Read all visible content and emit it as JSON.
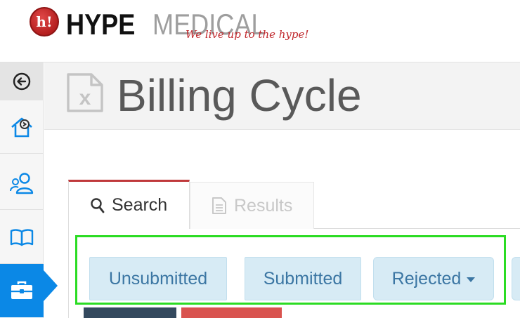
{
  "brand": {
    "badge_text": "h!",
    "name_part_1": "HYPE",
    "name_part_2": "MEDICAL",
    "tagline": "We live up to the hype!",
    "colors": {
      "red": "#c0282d",
      "gray": "#9e9e9e"
    }
  },
  "sidebar": {
    "toggle_icon": "arrow-circle-left-icon",
    "items": [
      {
        "icon": "home-icon",
        "active": false
      },
      {
        "icon": "users-icon",
        "active": false
      },
      {
        "icon": "book-icon",
        "active": false
      },
      {
        "icon": "briefcase-icon",
        "active": true
      }
    ],
    "active_color": "#0b88e6"
  },
  "page": {
    "title": "Billing Cycle",
    "title_icon": "excel-file-icon"
  },
  "tabs": [
    {
      "label": "Search",
      "icon": "search-icon",
      "active": true
    },
    {
      "label": "Results",
      "icon": "document-icon",
      "active": false
    }
  ],
  "status_filter": {
    "buttons": [
      {
        "label": "Unsubmitted"
      },
      {
        "label": "Submitted"
      },
      {
        "label": "Rejected",
        "has_dropdown": true
      }
    ],
    "highlight_color": "#2bdc23"
  }
}
